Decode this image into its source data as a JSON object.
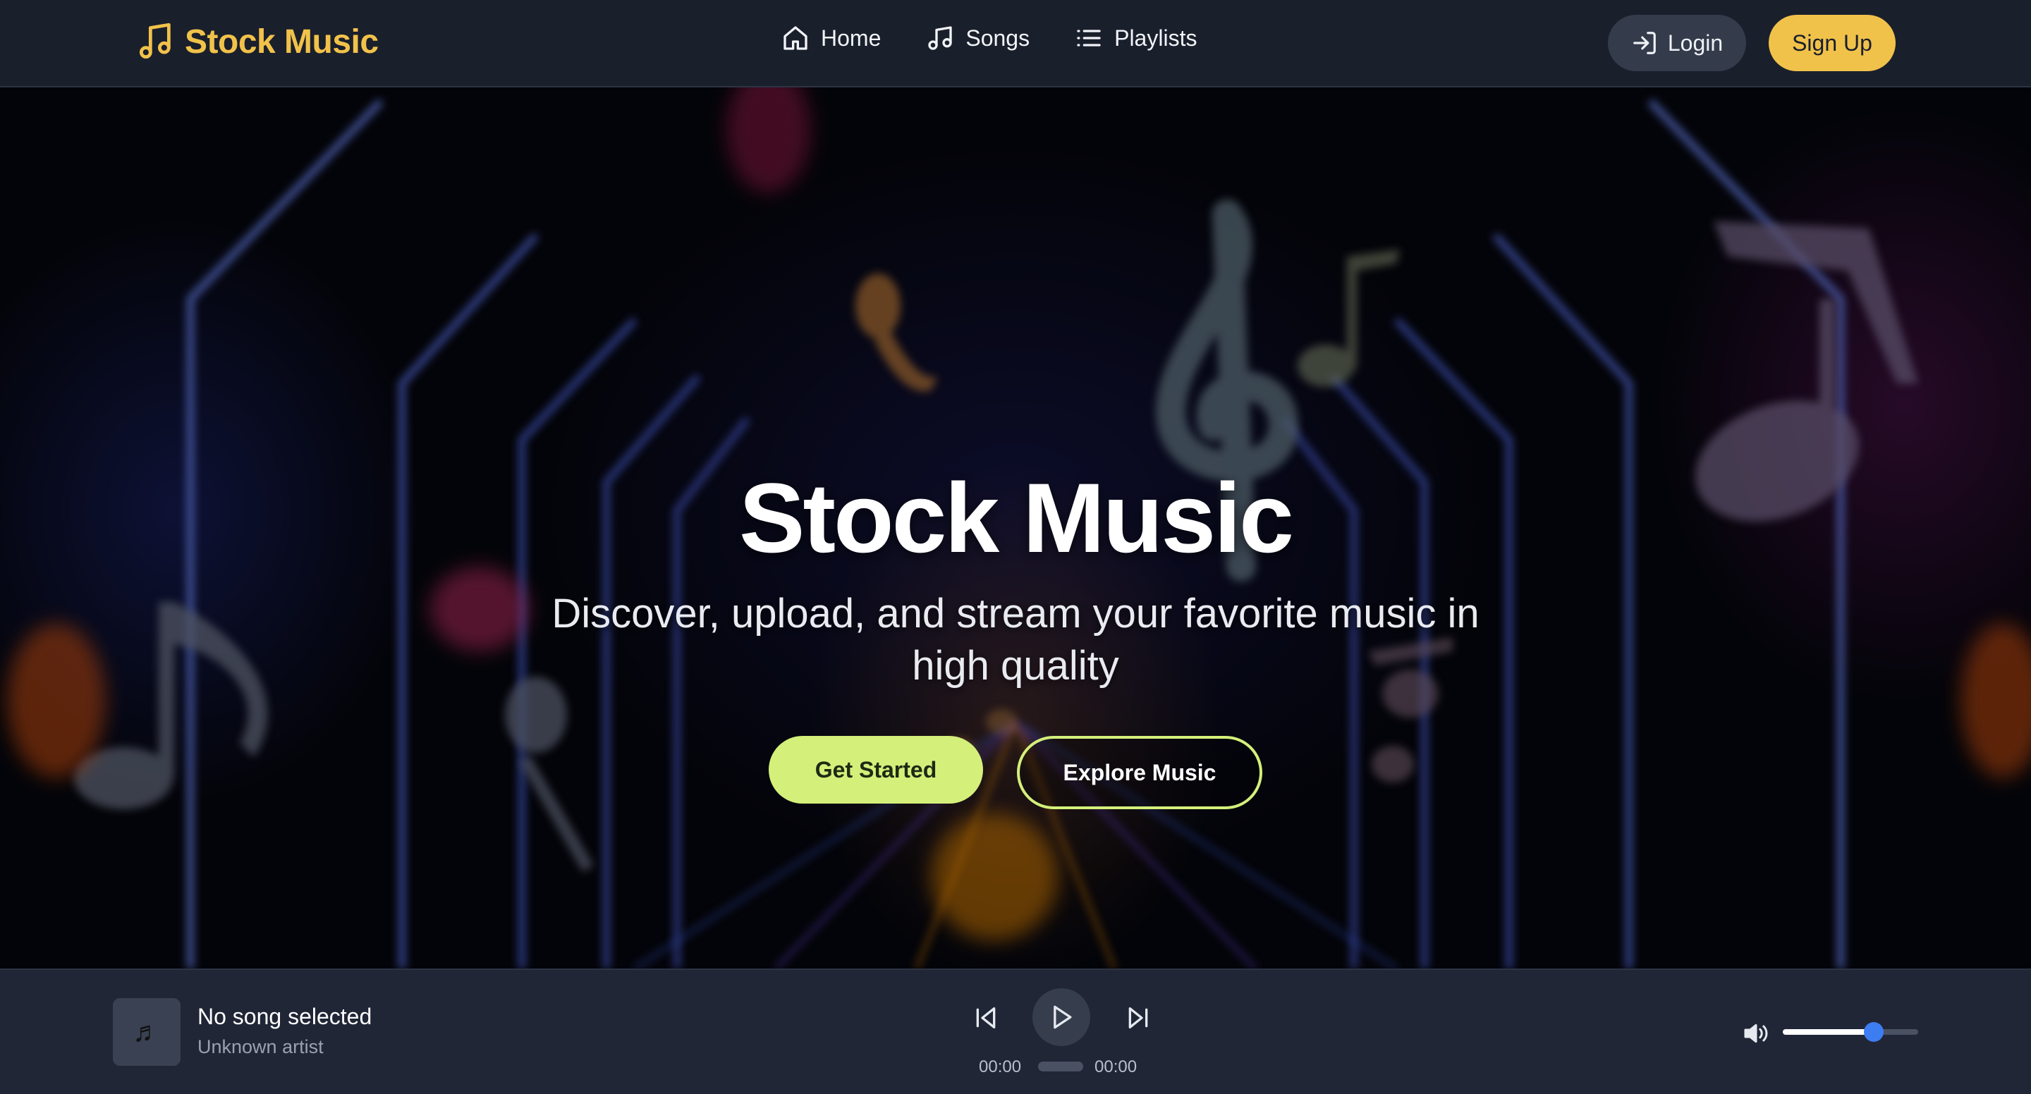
{
  "header": {
    "brand": "Stock Music",
    "brand_color": "#f1c24a",
    "nav": [
      {
        "label": "Home",
        "icon": "home-icon"
      },
      {
        "label": "Songs",
        "icon": "music-note-icon"
      },
      {
        "label": "Playlists",
        "icon": "list-icon"
      }
    ],
    "login_label": "Login",
    "signup_label": "Sign Up"
  },
  "hero": {
    "title": "Stock Music",
    "subtitle": "Discover, upload, and stream your favorite music in high quality",
    "primary_cta": "Get Started",
    "secondary_cta": "Explore Music",
    "accent_color": "#d4f07a"
  },
  "player": {
    "song_title": "No song selected",
    "artist": "Unknown artist",
    "artwork_icon": "music-note-icon",
    "current_time": "00:00",
    "total_time": "00:00",
    "progress": 0,
    "volume": 0.67
  }
}
